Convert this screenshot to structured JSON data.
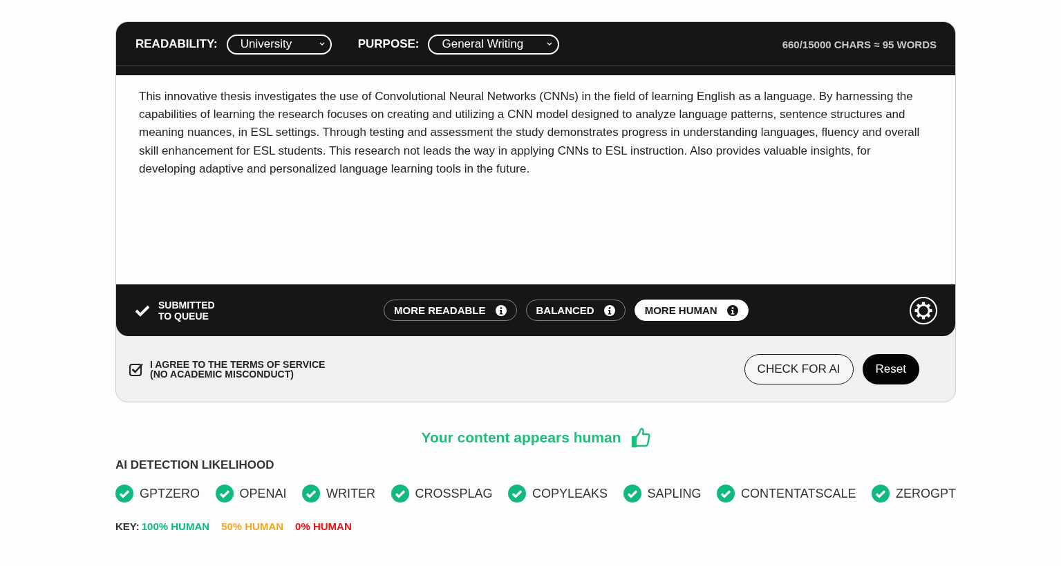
{
  "toolbar": {
    "readability": {
      "label": "READABILITY:",
      "value": "University"
    },
    "purpose": {
      "label": "PURPOSE:",
      "value": "General Writing"
    },
    "counter": "660/15000 CHARS ≈ 95 WORDS"
  },
  "text": "This innovative thesis investigates the use of Convolutional Neural Networks (CNNs) in the field of learning English as a language. By harnessing the capabilities of learning the research focuses on creating and utilizing a CNN model designed to analyze language patterns, sentence structures and meaning nuances, in ESL settings. Through testing and assessment the study demonstrates progress in understanding languages, fluency and overall skill enhancement for ESL students. This research not leads the way in applying CNNs to ESL instruction. Also provides valuable insights, for developing adaptive and personalized language learning tools in the future.",
  "status": {
    "lines": [
      "SUBMITTED",
      "TO QUEUE"
    ],
    "done": true
  },
  "modes": [
    {
      "label": "MORE READABLE",
      "selected": false
    },
    {
      "label": "BALANCED",
      "selected": false
    },
    {
      "label": "MORE HUMAN",
      "selected": true
    }
  ],
  "agreement": {
    "lines": [
      "I AGREE TO THE TERMS OF SERVICE",
      "(NO ACADEMIC MISCONDUCT)"
    ],
    "checked": true
  },
  "buttons": [
    {
      "label": "CHECK FOR AI",
      "kind": "outline"
    },
    {
      "label": "Reset",
      "kind": "solid"
    }
  ],
  "result": "Your content appears human",
  "detection": {
    "title": "AI DETECTION LIKELIHOOD",
    "detectors": [
      {
        "name": "GPTZERO",
        "color": "#10b981"
      },
      {
        "name": "OPENAI",
        "color": "#10b981"
      },
      {
        "name": "WRITER",
        "color": "#10b981"
      },
      {
        "name": "CROSSPLAG",
        "color": "#10b981"
      },
      {
        "name": "COPYLEAKS",
        "color": "#10b981"
      },
      {
        "name": "SAPLING",
        "color": "#10b981"
      },
      {
        "name": "CONTENTATSCALE",
        "color": "#10b981"
      },
      {
        "name": "ZEROGPT",
        "color": "#10b981"
      }
    ]
  },
  "key": {
    "label": "KEY:",
    "items": [
      {
        "text": "100% HUMAN",
        "color": "#10b981"
      },
      {
        "text": "50% HUMAN",
        "color": "#f5a623"
      },
      {
        "text": "0% HUMAN",
        "color": "#ee1111"
      }
    ]
  }
}
